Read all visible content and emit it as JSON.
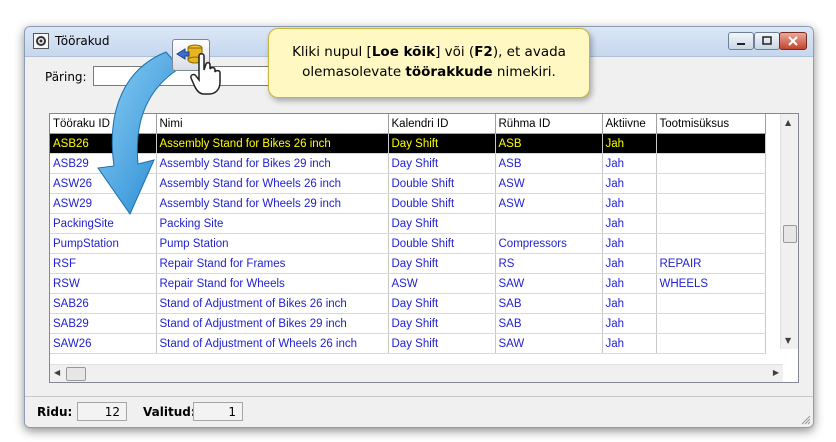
{
  "window": {
    "title": "Töörakud",
    "icon": "gear-icon"
  },
  "query": {
    "label": "Päring:",
    "value": ""
  },
  "callout": {
    "text_1": "Kliki nupul [",
    "bold_1": "Loe kõik",
    "text_2": "] või (",
    "bold_2": "F2",
    "text_3": "), et avada",
    "text_4": "olemasolevate ",
    "bold_3": "töörakkude",
    "text_5": " nimekiri."
  },
  "table": {
    "columns": [
      "Tööraku ID",
      "Nimi",
      "Kalendri ID",
      "Rühma ID",
      "Aktiivne",
      "Tootmisüksus"
    ],
    "rows": [
      [
        "ASB26",
        "Assembly Stand for Bikes 26 inch",
        "Day Shift",
        "ASB",
        "Jah",
        ""
      ],
      [
        "ASB29",
        "Assembly Stand for Bikes 29 inch",
        "Day Shift",
        "ASB",
        "Jah",
        ""
      ],
      [
        "ASW26",
        "Assembly Stand for Wheels 26 inch",
        "Double Shift",
        "ASW",
        "Jah",
        ""
      ],
      [
        "ASW29",
        "Assembly Stand for Wheels 29 inch",
        "Double Shift",
        "ASW",
        "Jah",
        ""
      ],
      [
        "PackingSite",
        "Packing Site",
        "Day Shift",
        "",
        "Jah",
        ""
      ],
      [
        "PumpStation",
        "Pump Station",
        "Double Shift",
        "Compressors",
        "Jah",
        ""
      ],
      [
        "RSF",
        "Repair Stand for Frames",
        "Day Shift",
        "RS",
        "Jah",
        "REPAIR"
      ],
      [
        "RSW",
        "Repair Stand for Wheels",
        "ASW",
        "SAW",
        "Jah",
        "WHEELS"
      ],
      [
        "SAB26",
        "Stand of Adjustment of Bikes 26 inch",
        "Day Shift",
        "SAB",
        "Jah",
        ""
      ],
      [
        "SAB29",
        "Stand of Adjustment of Bikes 29 inch",
        "Day Shift",
        "SAB",
        "Jah",
        ""
      ],
      [
        "SAW26",
        "Stand of Adjustment of Wheels 26 inch",
        "Day Shift",
        "SAW",
        "Jah",
        ""
      ]
    ],
    "selected_row": 0
  },
  "status": {
    "rows_label": "Ridu:",
    "rows_value": "12",
    "selected_label": "Valitud:",
    "selected_value": "1"
  },
  "colors": {
    "row_text": "#1f1fd0",
    "selected_bg": "#000000",
    "selected_text": "#ffff00",
    "callout_bg": "#fff8c2",
    "arrow": "#3aa0e0"
  }
}
